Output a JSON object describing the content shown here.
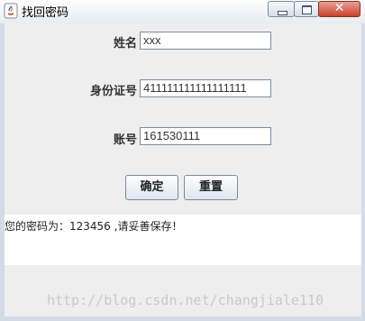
{
  "window": {
    "title": "找回密码",
    "close_glyph": "✕"
  },
  "form": {
    "name_label": "姓名",
    "name_value": "xxx",
    "id_label": "身份证号",
    "id_value": "411111111111111111",
    "account_label": "账号",
    "account_value": "161530111"
  },
  "buttons": {
    "confirm_label": "确定",
    "reset_label": "重置"
  },
  "result": {
    "message": "您的密码为：123456 ,请妥善保存！"
  },
  "watermark": {
    "text": "http://blog.csdn.net/changjiale110"
  }
}
